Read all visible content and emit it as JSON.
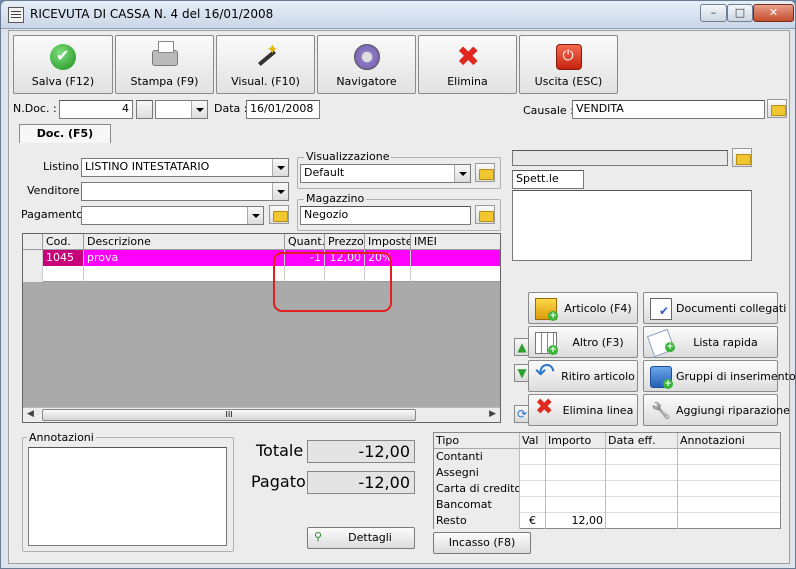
{
  "window": {
    "title": "RICEVUTA DI CASSA N. 4  del 16/01/2008",
    "min_glyph": "–",
    "max_glyph": "□",
    "close_glyph": "✕"
  },
  "toolbar": [
    {
      "label": "Salva (F12)",
      "icon": "check-icon"
    },
    {
      "label": "Stampa (F9)",
      "icon": "printer-icon"
    },
    {
      "label": "Visual. (F10)",
      "icon": "magic-wand-icon"
    },
    {
      "label": "Navigatore",
      "icon": "compass-icon"
    },
    {
      "label": "Elimina",
      "icon": "delete-x-icon"
    },
    {
      "label": "Uscita (ESC)",
      "icon": "exit-power-icon"
    }
  ],
  "header": {
    "ndoc_label": "N.Doc. :",
    "ndoc_value": "4",
    "data_label": "Data :",
    "data_value": "16/01/2008",
    "causale_label": "Causale :",
    "causale_value": "VENDITA"
  },
  "tab": {
    "label": "Doc. (F5)"
  },
  "form": {
    "listino_label": "Listino :",
    "listino_value": "LISTINO INTESTATARIO",
    "venditore_label": "Venditore :",
    "venditore_value": "",
    "pagamento_label": "Pagamento :",
    "pagamento_value": "",
    "visualizzazione_label": "Visualizzazione",
    "visualizzazione_value": "Default",
    "magazzino_label": "Magazzino",
    "magazzino_value": "Negozio",
    "cliente_value": "",
    "spett_value": "Spett.le",
    "address_value": ""
  },
  "grid": {
    "columns": [
      "Cod.",
      "Descrizione",
      "Quant.",
      "Prezzo",
      "Imposte",
      "IMEI"
    ],
    "rows": [
      {
        "cod": "1045",
        "descrizione": "prova",
        "quant": "-1",
        "prezzo": "12,00",
        "imposte": "20%",
        "imei": ""
      },
      {
        "cod": "",
        "descrizione": "",
        "quant": "",
        "prezzo": "",
        "imposte": "",
        "imei": ""
      }
    ],
    "scroll_thumb": "III"
  },
  "actions": [
    {
      "label": "Articolo (F4)",
      "icon": "box-add-icon"
    },
    {
      "label": "Documenti collegati",
      "icon": "linked-docs-icon"
    },
    {
      "label": "Altro (F3)",
      "icon": "grid-add-icon"
    },
    {
      "label": "Lista rapida",
      "icon": "quick-list-icon"
    },
    {
      "label": "Ritiro articolo",
      "icon": "undo-arrow-icon"
    },
    {
      "label": "Gruppi di inserimento",
      "icon": "group-add-icon"
    },
    {
      "label": "Elimina linea",
      "icon": "delete-x-icon"
    },
    {
      "label": "Aggiungi riparazione",
      "icon": "wrench-icon"
    }
  ],
  "annotazioni": {
    "label": "Annotazioni",
    "value": ""
  },
  "totals": {
    "totale_label": "Totale",
    "totale_value": "-12,00",
    "pagato_label": "Pagato",
    "pagato_value": "-12,00",
    "dettagli_label": "Dettagli"
  },
  "payments": {
    "columns": [
      "Tipo",
      "Val",
      "Importo",
      "Data eff.",
      "Annotazioni"
    ],
    "rows": [
      {
        "tipo": "Contanti",
        "val": "",
        "importo": "",
        "data": "",
        "note": ""
      },
      {
        "tipo": "Assegni",
        "val": "",
        "importo": "",
        "data": "",
        "note": ""
      },
      {
        "tipo": "Carta di credito",
        "val": "",
        "importo": "",
        "data": "",
        "note": ""
      },
      {
        "tipo": "Bancomat",
        "val": "",
        "importo": "",
        "data": "",
        "note": ""
      },
      {
        "tipo": "Resto",
        "val": "€",
        "importo": "12,00",
        "data": "",
        "note": ""
      }
    ],
    "incasso_label": "Incasso (F8)"
  }
}
